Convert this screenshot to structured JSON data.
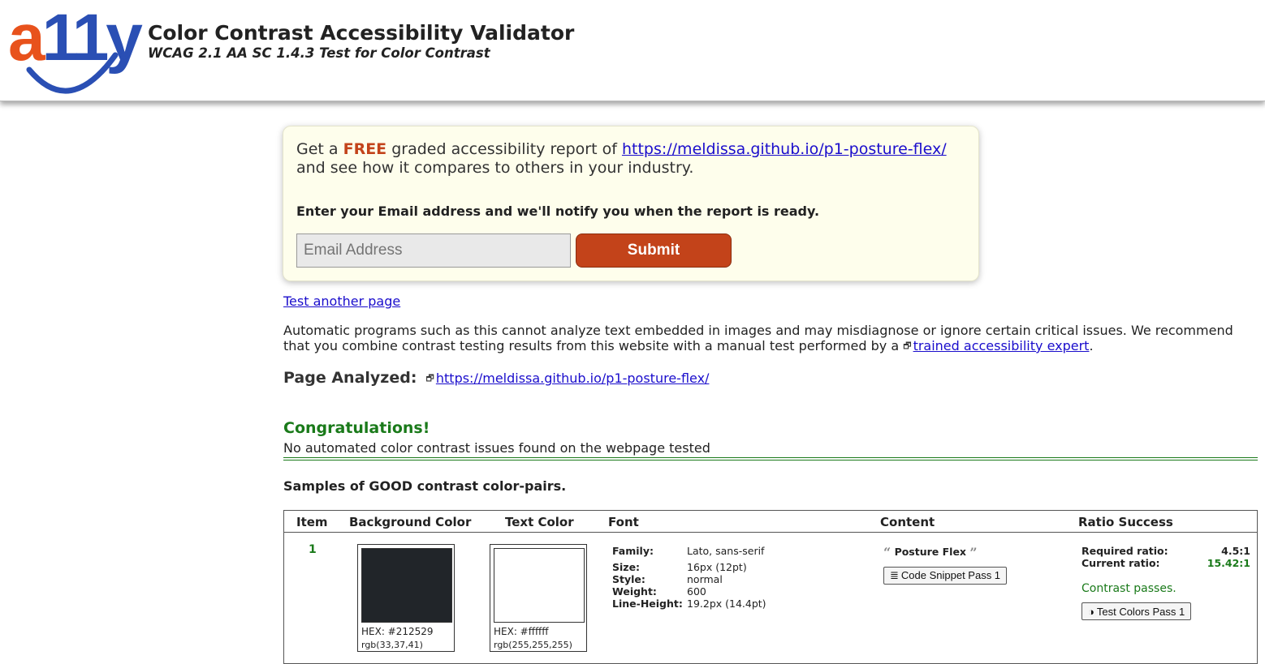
{
  "header": {
    "logo_text_a": "a",
    "logo_text_11y": "11y",
    "logo_reg": "®",
    "title": "Color Contrast Accessibility Validator",
    "subtitle": "WCAG 2.1 AA SC 1.4.3 Test for Color Contrast"
  },
  "promo": {
    "line1_prefix": "Get a",
    "free": "FREE",
    "line1_mid": "graded accessibility report of",
    "url": "https://meldissa.github.io/p1-posture-flex/",
    "line2": "and see how it compares to others in your industry.",
    "instruction": "Enter your Email address and we'll notify you when the report is ready.",
    "email_placeholder": "Email Address",
    "submit_label": "Submit"
  },
  "links": {
    "test_another": "Test another page"
  },
  "disclaimer": {
    "text": "Automatic programs such as this cannot analyze text embedded in images and may misdiagnose or ignore certain critical issues. We recommend that you combine contrast testing results from this website with a manual test performed by a",
    "expert_link": "trained accessibility expert",
    "end": "."
  },
  "analyzed": {
    "label": "Page Analyzed:",
    "url": "https://meldissa.github.io/p1-posture-flex/"
  },
  "result": {
    "title": "Congratulations!",
    "message": "No automated color contrast issues found on the webpage tested"
  },
  "samples": {
    "heading": "Samples of GOOD contrast color-pairs.",
    "columns": [
      "Item",
      "Background Color",
      "Text Color",
      "Font",
      "Content",
      "Ratio Success"
    ],
    "rows": [
      {
        "item": "1",
        "background": {
          "hex": "HEX: #212529",
          "rgb": "rgb(33,37,41)",
          "color": "#212529"
        },
        "text_color": {
          "hex": "HEX: #ffffff",
          "rgb": "rgb(255,255,255)",
          "color": "#ffffff"
        },
        "font": {
          "family_label": "Family:",
          "family": "Lato, sans-serif",
          "size_label": "Size:",
          "size": "16px (12pt)",
          "style_label": "Style:",
          "style": "normal",
          "weight_label": "Weight:",
          "weight": "600",
          "line_height_label": "Line-Height:",
          "line_height": "19.2px (14.4pt)"
        },
        "content": {
          "text": "Posture Flex",
          "snippet_button": "Code Snippet Pass 1"
        },
        "ratio": {
          "required_label": "Required ratio:",
          "required": "4.5:1",
          "current_label": "Current ratio:",
          "current": "15.42:1",
          "status": "Contrast passes.",
          "test_button": "Test Colors Pass 1"
        }
      }
    ]
  },
  "colors": {
    "accent_orange": "#c3431a",
    "link_blue": "#1a0dcc",
    "success_green": "#1a7a1a",
    "promo_bg": "#fefeec"
  }
}
